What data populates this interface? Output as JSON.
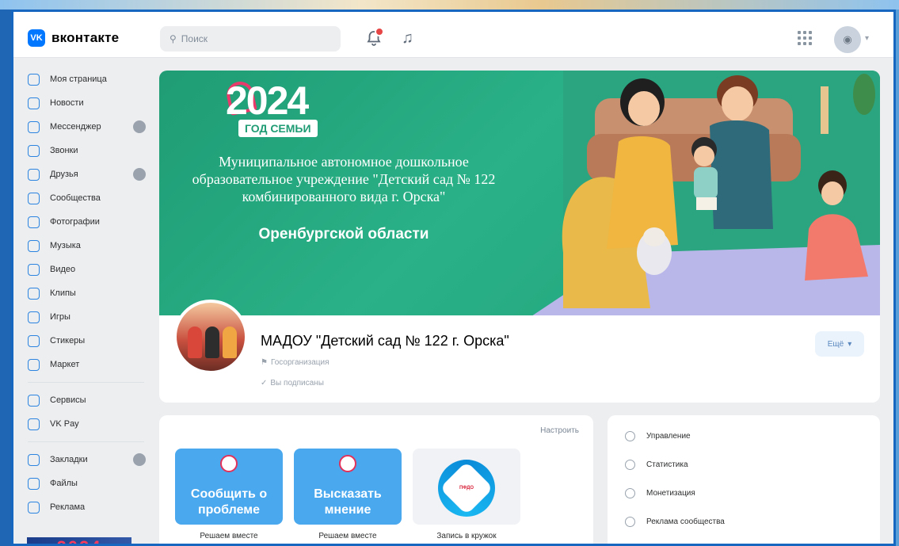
{
  "app": {
    "logo_text": "вконтакте",
    "logo_badge": "VK"
  },
  "search": {
    "placeholder": "Поиск"
  },
  "sidebar": {
    "items": [
      {
        "label": "Моя страница",
        "icon": "user-icon"
      },
      {
        "label": "Новости",
        "icon": "news-icon"
      },
      {
        "label": "Мессенджер",
        "icon": "message-icon",
        "count": true
      },
      {
        "label": "Звонки",
        "icon": "phone-icon"
      },
      {
        "label": "Друзья",
        "icon": "friends-icon",
        "count": true
      },
      {
        "label": "Сообщества",
        "icon": "communities-icon"
      },
      {
        "label": "Фотографии",
        "icon": "photo-icon"
      },
      {
        "label": "Музыка",
        "icon": "music-icon"
      },
      {
        "label": "Видео",
        "icon": "video-icon"
      },
      {
        "label": "Клипы",
        "icon": "clips-icon"
      },
      {
        "label": "Игры",
        "icon": "games-icon"
      },
      {
        "label": "Стикеры",
        "icon": "stickers-icon"
      },
      {
        "label": "Маркет",
        "icon": "market-icon"
      }
    ],
    "items2": [
      {
        "label": "Сервисы",
        "icon": "services-icon"
      },
      {
        "label": "VK Pay",
        "icon": "vkpay-icon"
      }
    ],
    "items3": [
      {
        "label": "Закладки",
        "icon": "bookmark-icon",
        "count": true
      },
      {
        "label": "Файлы",
        "icon": "file-icon"
      },
      {
        "label": "Реклама",
        "icon": "ads-icon"
      }
    ],
    "banner": "2024"
  },
  "cover": {
    "year": "2024",
    "year_label": "ГОД СЕМЬИ",
    "org_name": "Муниципальное автономное дошкольное образовательное учреждение \"Детский сад № 122 комбинированного вида г. Орска\"",
    "region": "Оренбургской области"
  },
  "profile": {
    "title": "МАДОУ \"Детский сад № 122 г. Орска\"",
    "type": "Госорганизация",
    "subscribed": "Вы подписаны",
    "more_label": "Ещё"
  },
  "main": {
    "customize": "Настроить",
    "tiles": [
      {
        "title": "Сообщить о проблеме",
        "caption": "Решаем вместе"
      },
      {
        "title": "Высказать мнение",
        "caption": "Решаем вместе"
      },
      {
        "title": "",
        "caption": "Запись в кружок",
        "logo_text": "ПФДО"
      }
    ]
  },
  "manage_menu": [
    {
      "label": "Управление",
      "icon": "settings-icon"
    },
    {
      "label": "Статистика",
      "icon": "stats-icon"
    },
    {
      "label": "Монетизация",
      "icon": "money-icon"
    },
    {
      "label": "Реклама сообщества",
      "icon": "promo-icon"
    }
  ],
  "colors": {
    "accent": "#0077ff",
    "cover": "#2ab187",
    "frame": "#1766c0"
  }
}
